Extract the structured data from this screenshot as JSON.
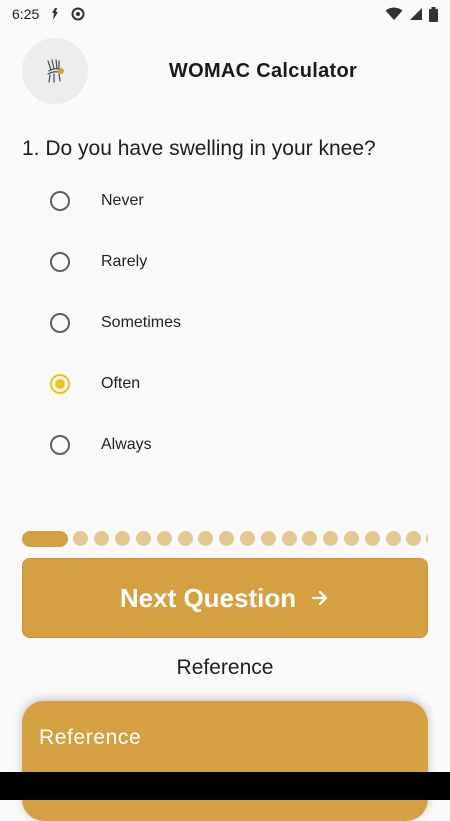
{
  "status_bar": {
    "time": "6:25"
  },
  "app": {
    "title": "WOMAC Calculator"
  },
  "question": {
    "text": "1. Do you have swelling in your knee?"
  },
  "options": [
    {
      "label": "Never",
      "selected": false
    },
    {
      "label": "Rarely",
      "selected": false
    },
    {
      "label": "Sometimes",
      "selected": false
    },
    {
      "label": "Often",
      "selected": true
    },
    {
      "label": "Always",
      "selected": false
    }
  ],
  "progress": {
    "current": 1
  },
  "actions": {
    "next_label": "Next Question"
  },
  "reference": {
    "link_label": "Reference",
    "card_title": "Reference"
  },
  "colors": {
    "accent": "#d4a042",
    "radio_selected": "#f2c21b",
    "progress_dot": "#e3c88f"
  }
}
